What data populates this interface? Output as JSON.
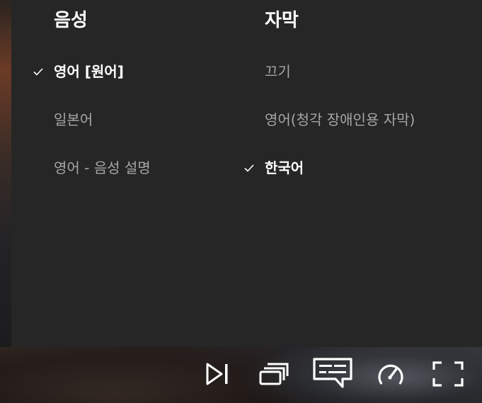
{
  "audio": {
    "heading": "음성",
    "options": [
      {
        "label": "영어 [원어]",
        "selected": true
      },
      {
        "label": "일본어",
        "selected": false
      },
      {
        "label": "영어 - 음성 설명",
        "selected": false
      }
    ]
  },
  "subtitles": {
    "heading": "자막",
    "options": [
      {
        "label": "끄기",
        "selected": false
      },
      {
        "label": "영어(청각 장애인용 자막)",
        "selected": false
      },
      {
        "label": "한국어",
        "selected": true
      }
    ]
  },
  "controls": {
    "icons": [
      "next-episode-icon",
      "episodes-icon",
      "subtitles-icon",
      "playback-speed-icon",
      "fullscreen-icon"
    ]
  },
  "colors": {
    "panel_bg": "#262626",
    "selected_text": "#ffffff",
    "unselected_text": "#a6a6a6"
  }
}
